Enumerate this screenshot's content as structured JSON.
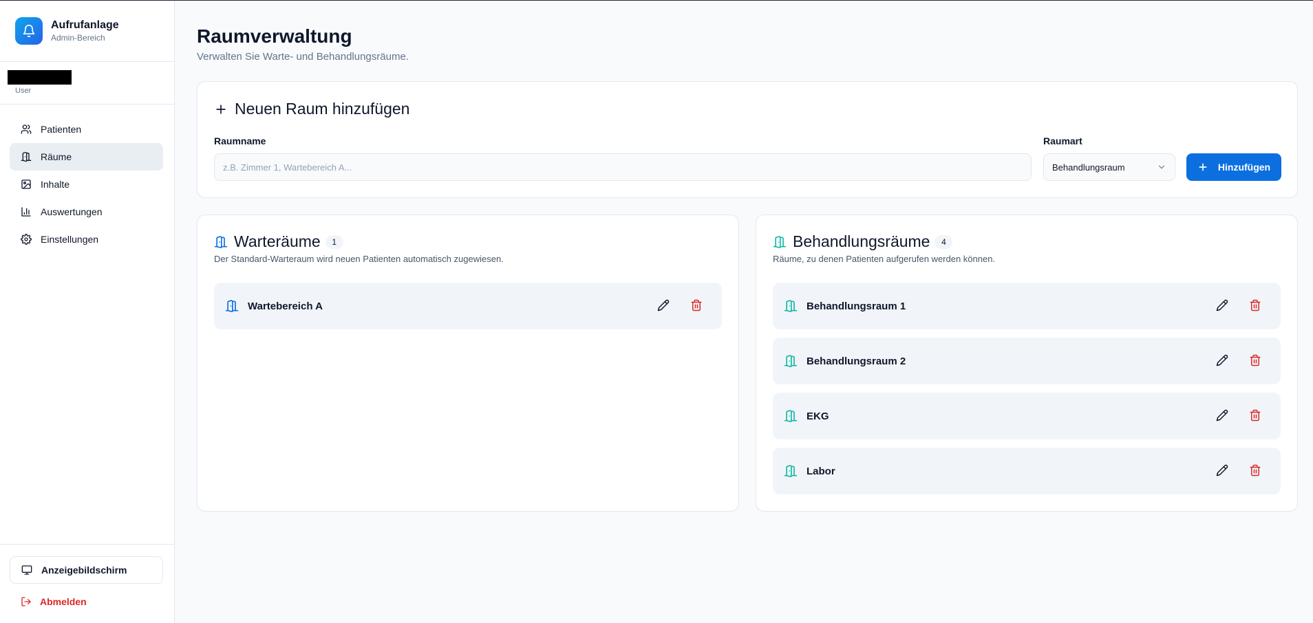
{
  "brand": {
    "title": "Aufrufanlage",
    "subtitle": "Admin-Bereich",
    "icon": "bell-icon",
    "color": "#0b6fe0"
  },
  "user": {
    "role": "User"
  },
  "nav": {
    "items": [
      {
        "label": "Patienten",
        "icon": "users-icon",
        "active": false
      },
      {
        "label": "Räume",
        "icon": "door-icon",
        "active": true
      },
      {
        "label": "Inhalte",
        "icon": "image-icon",
        "active": false
      },
      {
        "label": "Auswertungen",
        "icon": "bar-chart-icon",
        "active": false
      },
      {
        "label": "Einstellungen",
        "icon": "gear-icon",
        "active": false
      }
    ]
  },
  "footer": {
    "display_label": "Anzeigebildschirm",
    "logout_label": "Abmelden",
    "logout_color": "#dc2626"
  },
  "page": {
    "title": "Raumverwaltung",
    "subtitle": "Verwalten Sie Warte- und Behandlungsräume."
  },
  "add_room": {
    "title": "Neuen Raum hinzufügen",
    "name_label": "Raumname",
    "name_placeholder": "z.B. Zimmer 1, Wartebereich A...",
    "type_label": "Raumart",
    "type_value": "Behandlungsraum",
    "submit_label": "Hinzufügen"
  },
  "waiting_rooms": {
    "title": "Warteräume",
    "count": "1",
    "description": "Der Standard-Warteraum wird neuen Patienten automatisch zugewiesen.",
    "icon_color": "#0b6fe0",
    "rooms": [
      {
        "name": "Wartebereich A"
      }
    ]
  },
  "treatment_rooms": {
    "title": "Behandlungsräume",
    "count": "4",
    "description": "Räume, zu denen Patienten aufgerufen werden können.",
    "icon_color": "#14b8a6",
    "rooms": [
      {
        "name": "Behandlungsraum 1"
      },
      {
        "name": "Behandlungsraum 2"
      },
      {
        "name": "EKG"
      },
      {
        "name": "Labor"
      }
    ]
  }
}
